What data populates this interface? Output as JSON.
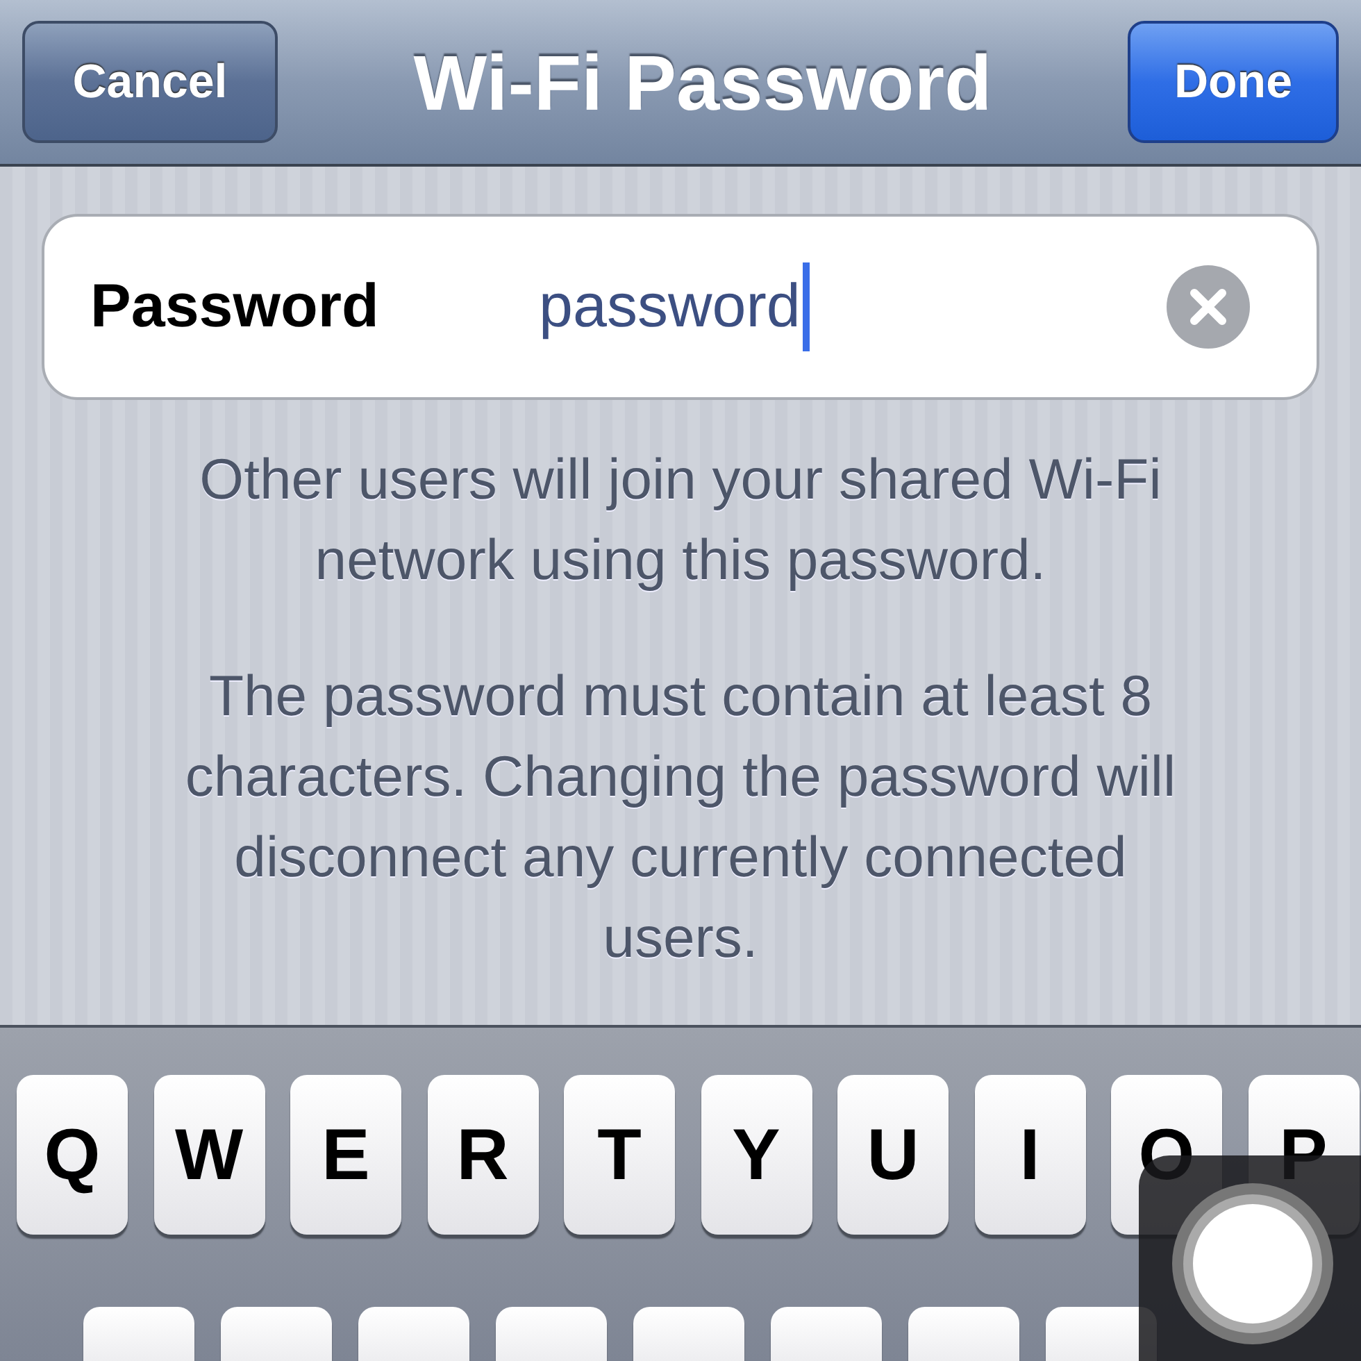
{
  "nav_bar": {
    "cancel_button": "Cancel",
    "title": "Wi-Fi Password",
    "done_button": "Done"
  },
  "password_field": {
    "label": "Password",
    "value": "password",
    "focused": true
  },
  "notes": [
    "Other users will join your shared Wi-Fi network using this password.",
    "The password must contain at least 8 characters. Changing the password will disconnect any currently connected users."
  ],
  "keyboard": {
    "rows": [
      [
        "Q",
        "W",
        "E",
        "R",
        "T",
        "Y",
        "U",
        "I",
        "O",
        "P"
      ]
    ]
  }
}
